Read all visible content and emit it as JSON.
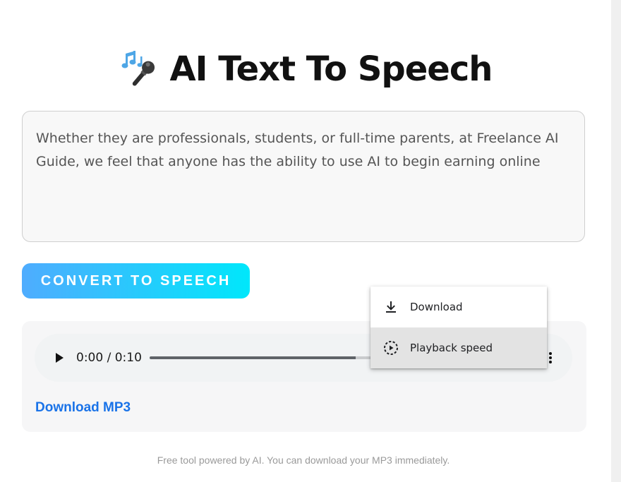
{
  "header": {
    "title": "AI Text To Speech",
    "icon": "microphone-music-icon"
  },
  "input": {
    "value": "Whether they are professionals, students, or full-time parents, at Freelance AI Guide, we feel that anyone has the ability to use AI to begin earning online"
  },
  "actions": {
    "convert_label": "CONVERT TO SPEECH"
  },
  "player": {
    "time": "0:00 / 0:10",
    "progress": 0.54,
    "play_icon": "play-icon",
    "more_icon": "more-vert-icon"
  },
  "menu": {
    "items": [
      {
        "label": "Download",
        "icon": "download-icon"
      },
      {
        "label": "Playback speed",
        "icon": "playback-speed-icon"
      }
    ]
  },
  "links": {
    "download_mp3": "Download MP3"
  },
  "footer": {
    "note": "Free tool powered by AI. You can download your MP3 immediately."
  },
  "colors": {
    "accent_gradient_start": "#4facfe",
    "accent_gradient_end": "#00e7fb",
    "link": "#1a73e8"
  }
}
